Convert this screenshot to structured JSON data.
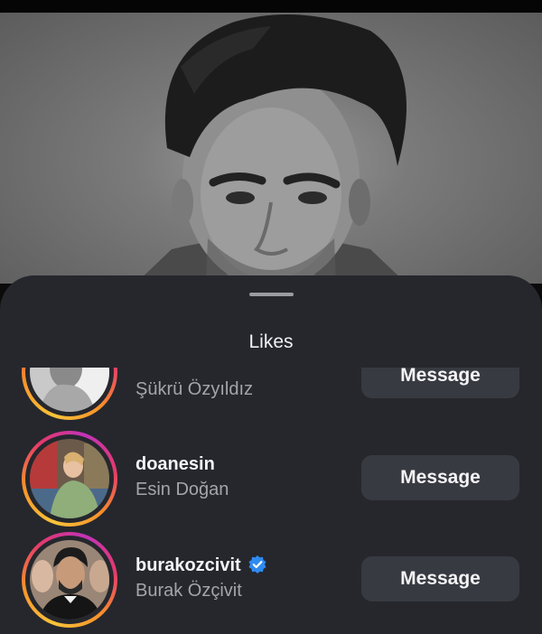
{
  "sheet": {
    "title": "Likes"
  },
  "likes": [
    {
      "username": "",
      "full_name": "Şükrü Özyıldız",
      "verified": false,
      "button_label": "Message"
    },
    {
      "username": "doanesin",
      "full_name": "Esin Doğan",
      "verified": false,
      "button_label": "Message"
    },
    {
      "username": "burakozcivit",
      "full_name": "Burak Özçivit",
      "verified": true,
      "button_label": "Message"
    }
  ],
  "colors": {
    "sheet_background": "#25272d",
    "button_background": "#383a41",
    "verified_badge": "#2f8bf0",
    "story_ring": [
      "#f9c33a",
      "#f7922a",
      "#e53a6b",
      "#c133b8"
    ]
  },
  "icons": {
    "verified": "verified-badge-icon"
  }
}
